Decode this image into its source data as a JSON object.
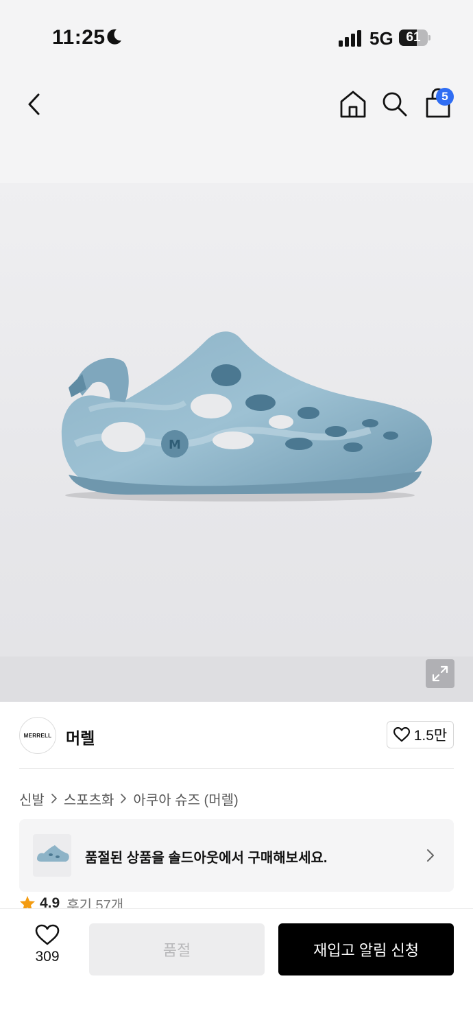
{
  "status_bar": {
    "time": "11:25",
    "network": "5G",
    "battery_level": "61",
    "battery_fraction": 0.61,
    "icons": [
      "moon-icon",
      "signal-icon",
      "battery-icon"
    ]
  },
  "nav": {
    "icons": [
      "back-icon",
      "home-icon",
      "search-icon",
      "shopping-bag-icon"
    ],
    "cart_count": "5",
    "badge_color": "#2f6df3"
  },
  "hero": {
    "image": "shoe-image",
    "expand_icon": "expand-icon"
  },
  "brand": {
    "logo_text": "MERRELL",
    "name": "머렐",
    "like_count": "1.5만"
  },
  "breadcrumb": [
    "신발",
    "스포츠화",
    "아쿠아 슈즈 (머렐)"
  ],
  "soldout_banner": {
    "text": "품절된 상품을 솔드아웃에서 구매해보세요."
  },
  "rating": {
    "score": "4.9",
    "reviews": "후기 57개",
    "star_color": "#f39c12"
  },
  "bottom_bar": {
    "wish_count": "309",
    "soldout_label": "품절",
    "restock_label": "재입고 알림 신청"
  }
}
